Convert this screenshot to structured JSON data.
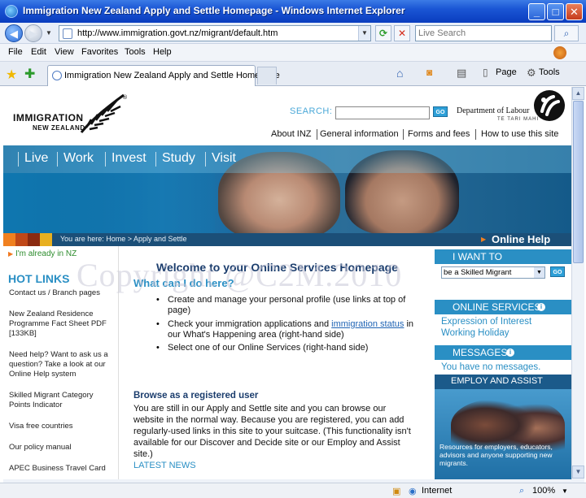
{
  "window": {
    "title": "Immigration New Zealand Apply and Settle Homepage - Windows Internet Explorer",
    "buttons": {
      "minimize": "_",
      "maximize": "□",
      "close": "✕"
    }
  },
  "address": {
    "url": "http://www.immigration.govt.nz/migrant/default.htm",
    "live_search_placeholder": "Live Search"
  },
  "menu": [
    "File",
    "Edit",
    "View",
    "Favorites",
    "Tools",
    "Help"
  ],
  "tab": {
    "label": "Immigration New Zealand Apply and Settle Homepage"
  },
  "command_bar": {
    "page": "Page",
    "tools": "Tools"
  },
  "header": {
    "logo_line1": "IMMIGRATION",
    "logo_line2": "NEW ZEALAND",
    "search_label": "SEARCH:",
    "go": "GO",
    "dept": "Department of Labour",
    "dept_sub": "TE TARI MAHI",
    "top_links": [
      "About INZ",
      "General information",
      "Forms and fees",
      "How to use this site"
    ]
  },
  "banner": {
    "nav": [
      "Live",
      "Work",
      "Invest",
      "Study",
      "Visit"
    ],
    "breadcrumb": "You are here: Home > Apply and Settle",
    "online_help": "Online Help",
    "crumb_colors": [
      "#f08020",
      "#c04818",
      "#8a2a10",
      "#e8b020"
    ]
  },
  "left": {
    "already": "I'm already in NZ",
    "hot_links_title": "HOT LINKS",
    "links": [
      "Contact us / Branch pages",
      "New Zealand Residence Programme Fact Sheet PDF [133KB]",
      "Need help? Want to ask us a question? Take a look at our Online Help system",
      "Skilled Migrant Category Points Indicator",
      "Visa free countries",
      "Our policy manual",
      "APEC Business Travel Card"
    ]
  },
  "main": {
    "welcome": "Welcome to your Online Services Homepage",
    "what_can": "What can I do here?",
    "bullets": {
      "b1": "Create and manage your personal profile (use links at top of page)",
      "b2_pre": "Check your immigration applications and ",
      "b2_link": "immigration status",
      "b2_post": " in our What's Happening area (right-hand side)",
      "b3": "Select one of our Online Services (right-hand side)"
    },
    "browse_title": "Browse as a registered user",
    "browse_text": "You are still in our Apply and Settle site and you can browse our website in the normal way. Because you are registered, you can add regularly-used links in this site to your suitcase. (This functionality isn't available for our Discover and Decide site or our Employ and Assist site.)",
    "latest_news": "LATEST NEWS"
  },
  "right": {
    "i_want_to": "I WANT TO",
    "select_value": "be a Skilled Migrant",
    "go": "GO",
    "online_services": "ONLINE SERVICES",
    "services": [
      "Expression of Interest",
      "Working Holiday"
    ],
    "messages": "MESSAGES",
    "no_messages": "You have no messages.",
    "employ_assist": "EMPLOY AND ASSIST",
    "assist_caption": "Resources for employers, educators, advisors and anyone supporting new migrants."
  },
  "watermark": "Copyright @C2M.2010",
  "status": {
    "zone": "Internet",
    "zoom": "100%"
  }
}
